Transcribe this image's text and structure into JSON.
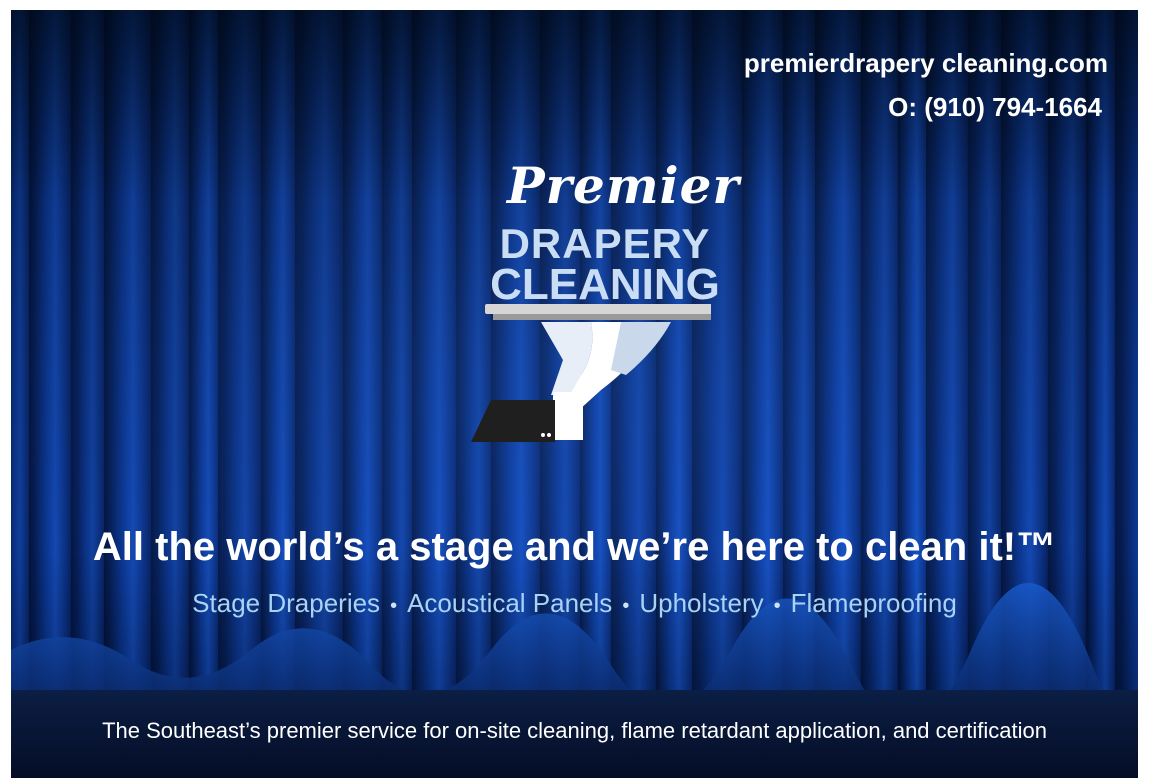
{
  "contact": {
    "website": "premierdrapery cleaning.com",
    "phone": "O: (910) 794-1664"
  },
  "logo": {
    "line1": "Premier",
    "line2": "DRAPERY",
    "line3": "CLEANING",
    "graphic": "gloved-hand-holding-tray"
  },
  "tagline": "All the world’s a stage and we’re here to clean it!™",
  "services": [
    "Stage Draperies",
    "Acoustical Panels",
    "Upholstery",
    "Flameproofing"
  ],
  "separator": "•",
  "footer": "The Southeast’s premier service for on-site cleaning, flame retardant application, and certification",
  "colors": {
    "curtain": "#0a3a9c",
    "curtain_dark": "#020a24",
    "logo_block": "#c9def5",
    "services_text": "#a9d3f5"
  }
}
